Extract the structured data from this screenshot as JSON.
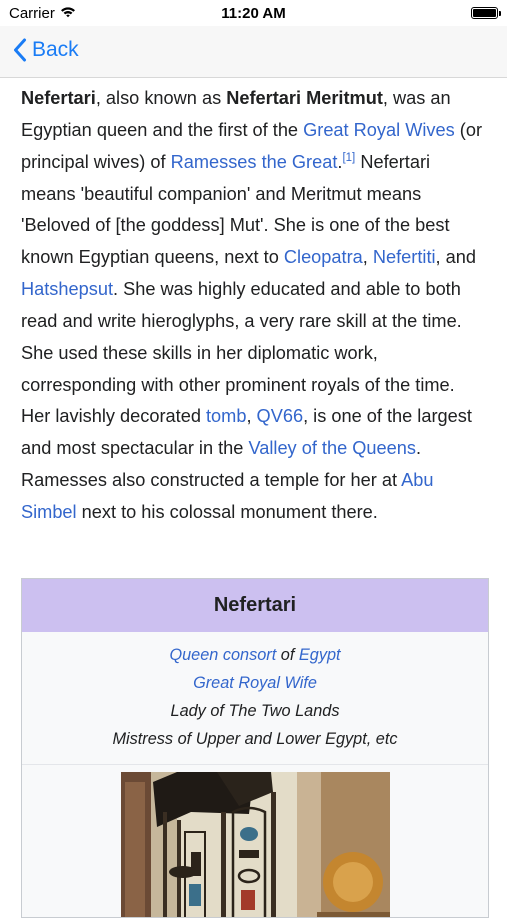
{
  "status_bar": {
    "carrier": "Carrier",
    "time": "11:20 AM"
  },
  "nav": {
    "back_label": "Back"
  },
  "article": {
    "p1_b1": "Nefertari",
    "p1_t1": ", also known as ",
    "p1_b2": "Nefertari Meritmut",
    "p1_t2": ", was an Egyptian queen and the first of the ",
    "l_great_royal_wives": "Great Royal Wives",
    "p1_t3": " (or principal wives) of ",
    "l_ramesses": "Ramesses the Great",
    "p1_t4": ".",
    "ref1": "[1]",
    "p1_t5": " Nefertari means 'beautiful companion' and Meritmut means 'Beloved of [the goddess] Mut'. She is one of the best known Egyptian queens, next to ",
    "l_cleopatra": "Cleopatra",
    "p1_t6": ", ",
    "l_nefertiti": "Nefertiti",
    "p1_t7": ", and ",
    "l_hatshepsut": "Hatshepsut",
    "p1_t8": ". She was highly educated and able to both read and write hieroglyphs, a very rare skill at the time. She used these skills in her diplomatic work, corresponding with other prominent royals of the time. Her lavishly decorated ",
    "l_tomb": "tomb",
    "p1_t9": ", ",
    "l_qv66": "QV66",
    "p1_t10": ", is one of the largest and most spectacular in the ",
    "l_valley": "Valley of the Queens",
    "p1_t11": ". Ramesses also constructed a temple for her at ",
    "l_abu_simbel": "Abu Simbel",
    "p1_t12": " next to his colossal monument there."
  },
  "infobox": {
    "title": "Nefertari",
    "role1_link1": "Queen consort",
    "role1_text": " of ",
    "role1_link2": "Egypt",
    "role2_link": "Great Royal Wife",
    "role3": "Lady of The Two Lands",
    "role4": "Mistress of Upper and Lower Egypt, etc"
  },
  "colors": {
    "link": "#3366cc",
    "ios_tint": "#1a7cf5",
    "infobox_header": "#ccc0f0",
    "text": "#202122"
  },
  "icons": [
    "wifi-icon",
    "battery-icon",
    "chevron-left-icon"
  ]
}
